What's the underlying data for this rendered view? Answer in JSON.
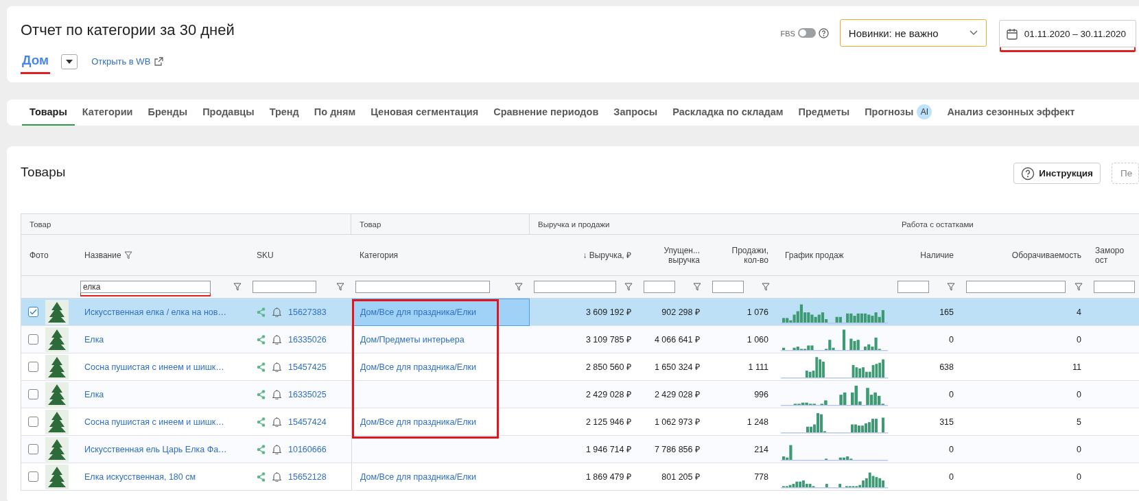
{
  "header": {
    "title": "Отчет по категории за 30 дней",
    "category": "Дом",
    "category_underlined": true,
    "open_link": "Открыть в WB",
    "fbs_label": "FBS",
    "fbs_on": false,
    "novelty_select": "Новинки: не важно",
    "date_range": "01.11.2020 – 30.11.2020",
    "date_underlined": true
  },
  "tabs": [
    {
      "label": "Товары",
      "selected": true
    },
    {
      "label": "Категории",
      "selected": false
    },
    {
      "label": "Бренды",
      "selected": false
    },
    {
      "label": "Продавцы",
      "selected": false
    },
    {
      "label": "Тренд",
      "selected": false
    },
    {
      "label": "По дням",
      "selected": false
    },
    {
      "label": "Ценовая сегментация",
      "selected": false
    },
    {
      "label": "Сравнение периодов",
      "selected": false
    },
    {
      "label": "Запросы",
      "selected": false
    },
    {
      "label": "Раскладка по складам",
      "selected": false
    },
    {
      "label": "Предметы",
      "selected": false
    },
    {
      "label": "Прогнозы",
      "selected": false,
      "badge": "AI"
    },
    {
      "label": "Анализ сезонных эффект",
      "selected": false
    }
  ],
  "section": {
    "title": "Товары",
    "instruction_button": "Инструкция",
    "cut_button": "Пе"
  },
  "table": {
    "groups": [
      {
        "label": "Товар"
      },
      {
        "label": "Товар"
      },
      {
        "label": "Выручка и продажи"
      },
      {
        "label": "Работа с остатками"
      }
    ],
    "columns": [
      {
        "label": "Фото",
        "kind": "photo",
        "filter": false,
        "filtered": false
      },
      {
        "label": "Название",
        "kind": "name",
        "filter": true,
        "filtered": true,
        "filter_value": "елка",
        "filter_underlined": true
      },
      {
        "label": "SKU",
        "kind": "sku",
        "filter": true,
        "filtered": false
      },
      {
        "label": "Категория",
        "kind": "category",
        "filter": true,
        "filtered": false
      },
      {
        "label": "↓ Выручка, ₽",
        "kind": "number",
        "filter": true,
        "filtered": false
      },
      {
        "label": "Упущен...\nвыручка",
        "kind": "number",
        "filter": true,
        "filtered": false
      },
      {
        "label": "Продажи,\nкол-во",
        "kind": "number",
        "filter": true,
        "filtered": false
      },
      {
        "label": "График продаж",
        "kind": "chart",
        "filter": false,
        "filtered": false
      },
      {
        "label": "Наличие",
        "kind": "number",
        "filter": true,
        "filtered": false
      },
      {
        "label": "Оборачиваемость",
        "kind": "number",
        "filter": true,
        "filtered": false
      },
      {
        "label": "Заморо\nост",
        "kind": "number",
        "filter": true,
        "filtered": false
      }
    ],
    "rows": [
      {
        "selected": true,
        "name": "Искусственная елка / елка на нов…",
        "sku": "15627383",
        "category": "Дом/Все для праздника/Елки",
        "category_focused": true,
        "framed": true,
        "revenue": "3 609 192 ₽",
        "lost_revenue": "902 298 ₽",
        "sales": "1 076",
        "stock": "165",
        "turnover": "4"
      },
      {
        "selected": false,
        "name": "Елка",
        "sku": "16335026",
        "category": "Дом/Предметы интерьера",
        "category_focused": false,
        "framed": true,
        "revenue": "3 109 785 ₽",
        "lost_revenue": "4 066 641 ₽",
        "sales": "1 060",
        "stock": "0",
        "turnover": "0"
      },
      {
        "selected": false,
        "name": "Сосна пушистая с инеем и шишк…",
        "sku": "15457425",
        "category": "Дом/Все для праздника/Елки",
        "category_focused": false,
        "framed": true,
        "revenue": "2 850 560 ₽",
        "lost_revenue": "1 650 324 ₽",
        "sales": "1 111",
        "stock": "638",
        "turnover": "11"
      },
      {
        "selected": false,
        "name": "Елка",
        "sku": "16335025",
        "category_focused": false,
        "framed": true,
        "revenue": "2 429 028 ₽",
        "lost_revenue": "2 429 028 ₽",
        "sales": "996",
        "stock": "0",
        "turnover": "0"
      },
      {
        "selected": false,
        "name": "Сосна пушистая с инеем и шишк…",
        "sku": "15457424",
        "category": "Дом/Все для праздника/Елки",
        "category_focused": false,
        "framed": true,
        "revenue": "2 125 946 ₽",
        "lost_revenue": "1 062 973 ₽",
        "sales": "1 248",
        "stock": "315",
        "turnover": "5"
      },
      {
        "selected": false,
        "name": "Искусственная ель Царь Елка Фа…",
        "sku": "10160666",
        "category_focused": false,
        "framed": false,
        "revenue": "1 946 714 ₽",
        "lost_revenue": "7 786 856 ₽",
        "sales": "214",
        "stock": "0",
        "turnover": "0"
      },
      {
        "selected": false,
        "name": "Елка искусственная, 180 см",
        "sku": "15652128",
        "category": "Дом/Все для праздника/Елки",
        "category_focused": false,
        "framed": false,
        "revenue": "1 869 479 ₽",
        "lost_revenue": "801 205 ₽",
        "sales": "778",
        "stock": "0",
        "turnover": "0"
      }
    ]
  }
}
